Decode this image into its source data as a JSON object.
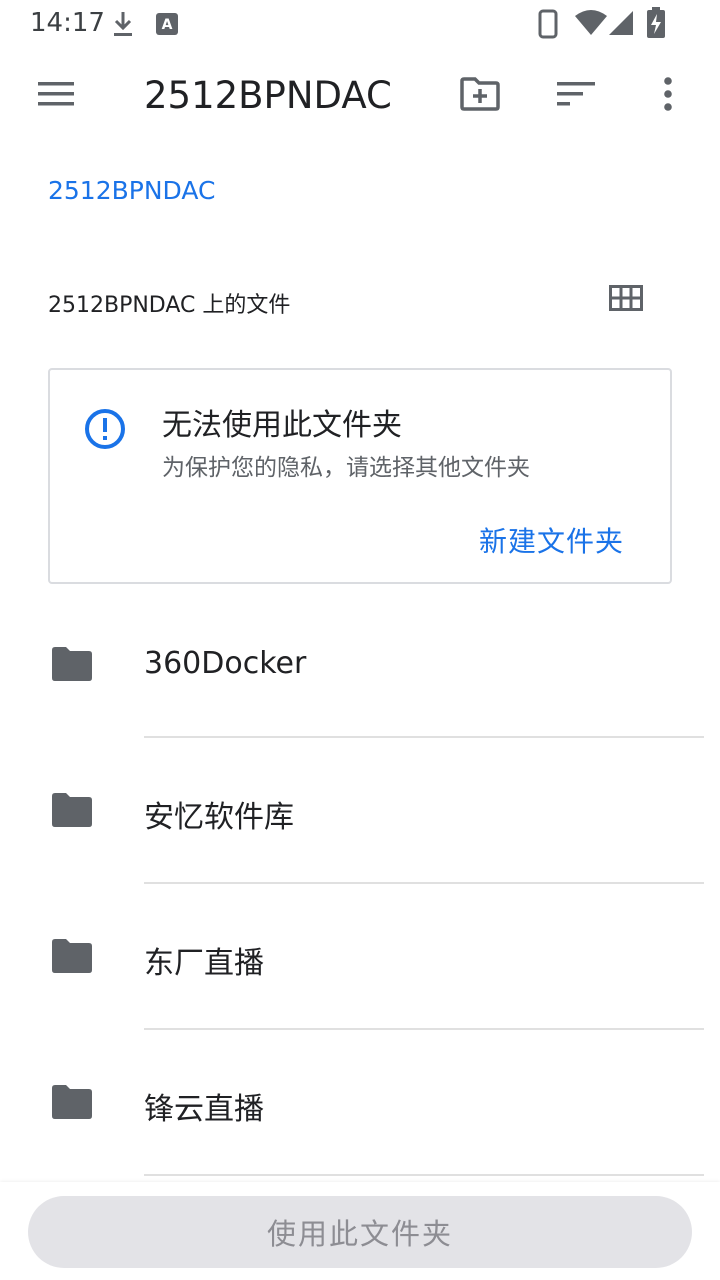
{
  "status_bar": {
    "time": "14:17",
    "icons": [
      "download-icon",
      "notification-a-icon",
      "phone-icon",
      "wifi-icon",
      "signal-icon",
      "battery-charging-icon"
    ]
  },
  "app_bar": {
    "title": "2512BPNDAC",
    "icons": [
      "menu-icon",
      "new-folder-icon",
      "sort-icon",
      "more-vert-icon"
    ]
  },
  "breadcrumb": "2512BPNDAC",
  "section_header": "2512BPNDAC 上的文件",
  "warning": {
    "title": "无法使用此文件夹",
    "subtitle": "为保护您的隐私，请选择其他文件夹",
    "action": "新建文件夹"
  },
  "folders": [
    {
      "name": "360Docker"
    },
    {
      "name": "安忆软件库"
    },
    {
      "name": "东厂直播"
    },
    {
      "name": "锋云直播"
    }
  ],
  "bottom_button": "使用此文件夹",
  "colors": {
    "accent": "#1a73e8",
    "icon_gray": "#5f6368",
    "disabled_bg": "#e3e3e7",
    "disabled_text": "#8d8d93"
  }
}
